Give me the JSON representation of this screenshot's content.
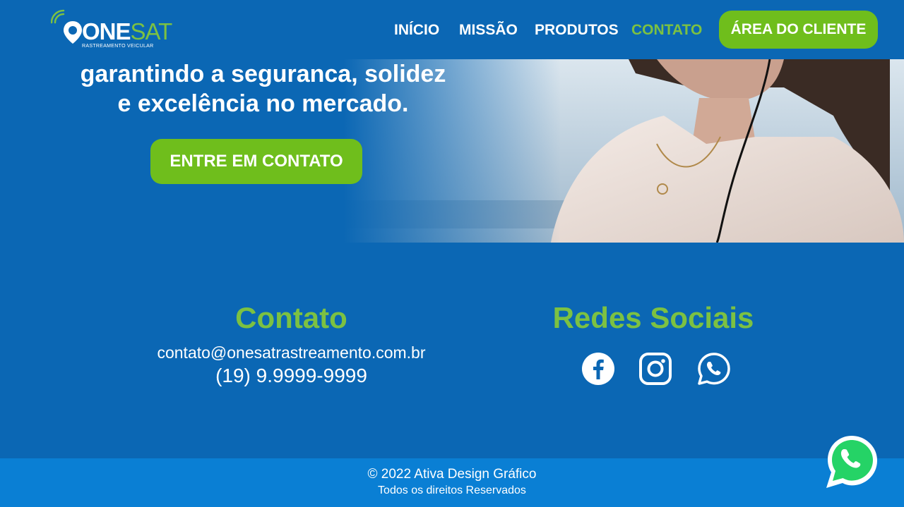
{
  "logo": {
    "text_white": "ONE",
    "text_green": "SAT",
    "subtitle": "RASTREAMENTO VEICULAR"
  },
  "nav": {
    "items": [
      {
        "label": "INÍCIO",
        "active": false
      },
      {
        "label": "MISSÃO",
        "active": false
      },
      {
        "label": "PRODUTOS",
        "active": false
      },
      {
        "label": "CONTATO",
        "active": true
      }
    ],
    "client_area_label": "ÁREA DO CLIENTE"
  },
  "hero": {
    "line1": "garantindo a seguranca, solidez",
    "line2": "e excelência no mercado.",
    "cta_label": "ENTRE EM CONTATO"
  },
  "contact": {
    "title": "Contato",
    "email": "contato@onesatrastreamento.com.br",
    "phone": "(19) 9.9999-9999"
  },
  "social": {
    "title": "Redes Sociais",
    "icons": [
      "facebook-icon",
      "instagram-icon",
      "whatsapp-icon"
    ]
  },
  "footer": {
    "copyright": "© 2022 Ativa Design Gráfico",
    "rights": "Todos os direitos Reservados"
  },
  "colors": {
    "background": "#0b67b4",
    "footer": "#0a7fd4",
    "accent_green": "#6fbe1c",
    "title_green": "#7cc142",
    "whatsapp_green": "#25d366"
  }
}
